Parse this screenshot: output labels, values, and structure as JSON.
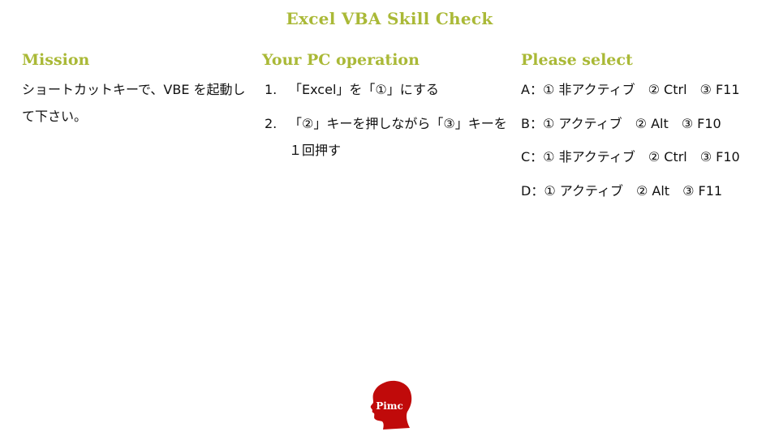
{
  "title": "Excel VBA Skill Check",
  "mission": {
    "heading": "Mission",
    "text": "ショートカットキーで、VBE を起動して下さい。"
  },
  "operation": {
    "heading": "Your PC operation",
    "steps": [
      {
        "num": "1.",
        "text": "「Excel」を「①」にする"
      },
      {
        "num": "2.",
        "text": "「②」キーを押しながら「③」キーを１回押す"
      }
    ]
  },
  "select": {
    "heading": "Please select",
    "options": [
      {
        "label": "A：① 非アクティブ　② Ctrl　③ F11"
      },
      {
        "label": "B：① アクティブ　② Alt　③ F10"
      },
      {
        "label": "C：① 非アクティブ　② Ctrl　③ F10"
      },
      {
        "label": "D：① アクティブ　② Alt　③ F11"
      }
    ]
  },
  "logo": {
    "text": "Pimc",
    "icon": "head-silhouette-icon",
    "color": "#c00a0a"
  },
  "colors": {
    "accent": "#aab937"
  }
}
